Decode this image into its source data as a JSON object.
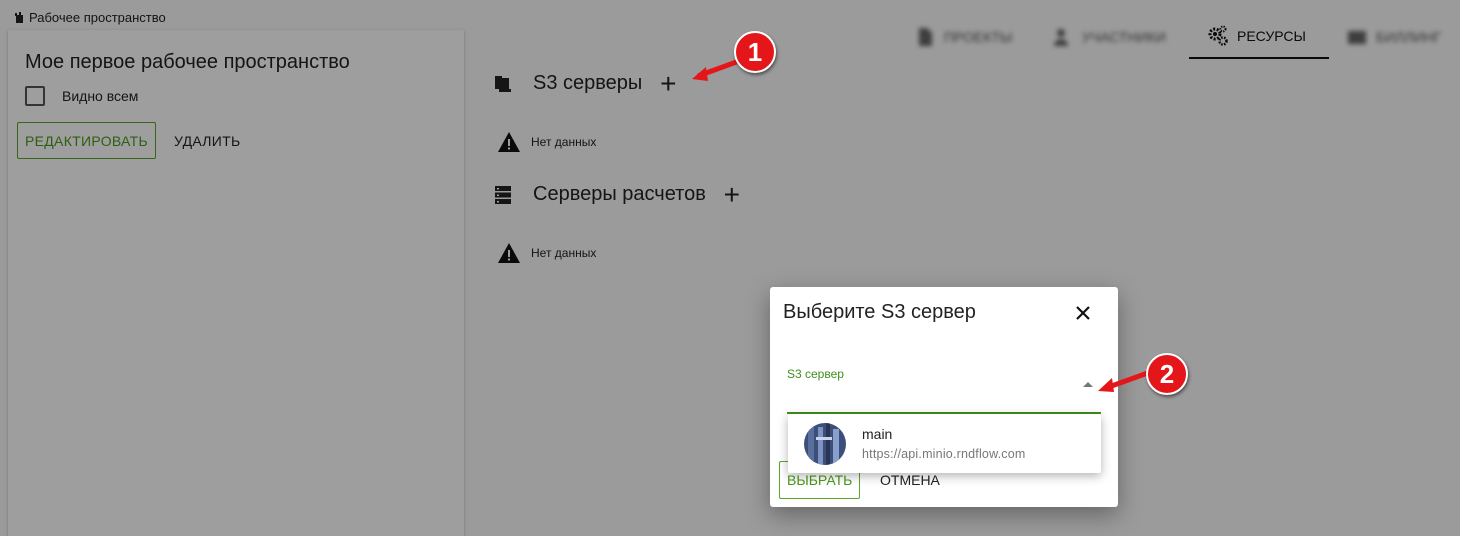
{
  "breadcrumb": {
    "label": "Рабочее пространство"
  },
  "workspace": {
    "title": "Мое первое рабочее пространство",
    "visible_label": "Видно всем",
    "edit_label": "РЕДАКТИРОВАТЬ",
    "delete_label": "УДАЛИТЬ"
  },
  "tabs": [
    {
      "label": "ПРОЕКТЫ",
      "icon": "file-icon",
      "blurred": true
    },
    {
      "label": "УЧАСТНИКИ",
      "icon": "people-icon",
      "blurred": true
    },
    {
      "label": "РЕСУРСЫ",
      "icon": "gears-icon",
      "active": true
    },
    {
      "label": "БИЛЛИНГ",
      "icon": "billing-icon",
      "blurred": true
    }
  ],
  "sections": {
    "s3": {
      "title": "S3 серверы",
      "empty": "Нет данных"
    },
    "compute": {
      "title": "Серверы расчетов",
      "empty": "Нет данных"
    }
  },
  "dialog": {
    "title": "Выберите S3 сервер",
    "field_label": "S3 сервер",
    "choose_label": "ВЫБРАТЬ",
    "cancel_label": "ОТМЕНА"
  },
  "menu": {
    "items": [
      {
        "primary": "main",
        "secondary": "https://api.minio.rndflow.com"
      }
    ]
  },
  "callouts": [
    "1",
    "2"
  ],
  "colors": {
    "accent": "#4a9a1e",
    "callout": "#e4161a"
  }
}
